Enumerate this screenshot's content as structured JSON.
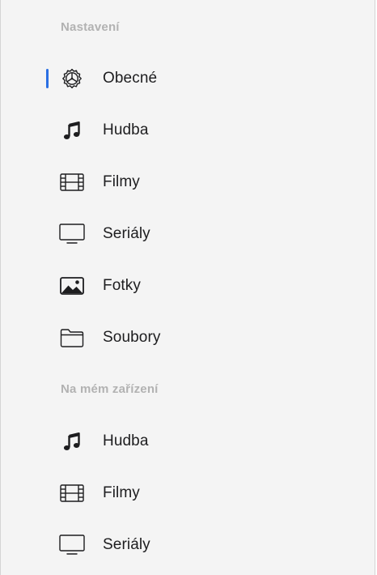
{
  "sidebar": {
    "accent_color": "#2a6fe3",
    "sections": [
      {
        "header": "Nastavení",
        "items": [
          {
            "label": "Obecné",
            "icon": "gear-icon",
            "selected": true
          },
          {
            "label": "Hudba",
            "icon": "music-note-icon",
            "selected": false
          },
          {
            "label": "Filmy",
            "icon": "film-icon",
            "selected": false
          },
          {
            "label": "Seriály",
            "icon": "tv-icon",
            "selected": false
          },
          {
            "label": "Fotky",
            "icon": "photo-icon",
            "selected": false
          },
          {
            "label": "Soubory",
            "icon": "folder-icon",
            "selected": false
          }
        ]
      },
      {
        "header": "Na mém zařízení",
        "items": [
          {
            "label": "Hudba",
            "icon": "music-note-icon",
            "selected": false
          },
          {
            "label": "Filmy",
            "icon": "film-icon",
            "selected": false
          },
          {
            "label": "Seriály",
            "icon": "tv-icon",
            "selected": false
          }
        ]
      }
    ]
  }
}
